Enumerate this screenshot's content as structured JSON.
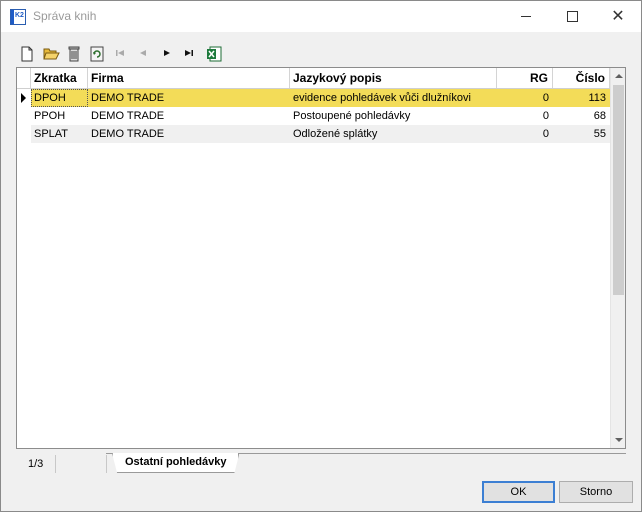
{
  "window": {
    "title": "Správa knih",
    "app_icon_text": "K2"
  },
  "toolbar": {
    "icons": [
      "new-file-icon",
      "open-folder-icon",
      "delete-icon",
      "refresh-icon",
      "first-record-icon",
      "previous-record-icon",
      "next-record-icon",
      "last-record-icon",
      "excel-export-icon"
    ]
  },
  "grid": {
    "columns": [
      "Zkratka",
      "Firma",
      "Jazykový popis",
      "RG",
      "Číslo"
    ],
    "rows": [
      {
        "zkratka": "DPOH",
        "firma": "DEMO TRADE",
        "popis": "evidence pohledávek vůči dlužníkovi",
        "rg": "0",
        "cislo": "113"
      },
      {
        "zkratka": "PPOH",
        "firma": "DEMO TRADE",
        "popis": "Postoupené pohledávky",
        "rg": "0",
        "cislo": "68"
      },
      {
        "zkratka": "SPLAT",
        "firma": "DEMO TRADE",
        "popis": "Odložené splátky",
        "rg": "0",
        "cislo": "55"
      }
    ],
    "selected_row_color": "#f3dc58"
  },
  "status": {
    "position": "1/3",
    "tab_label": "Ostatní pohledávky"
  },
  "buttons": {
    "ok": "OK",
    "cancel": "Storno"
  },
  "colors": {
    "accent": "#3c7fd3",
    "selection": "#f3dc58"
  }
}
